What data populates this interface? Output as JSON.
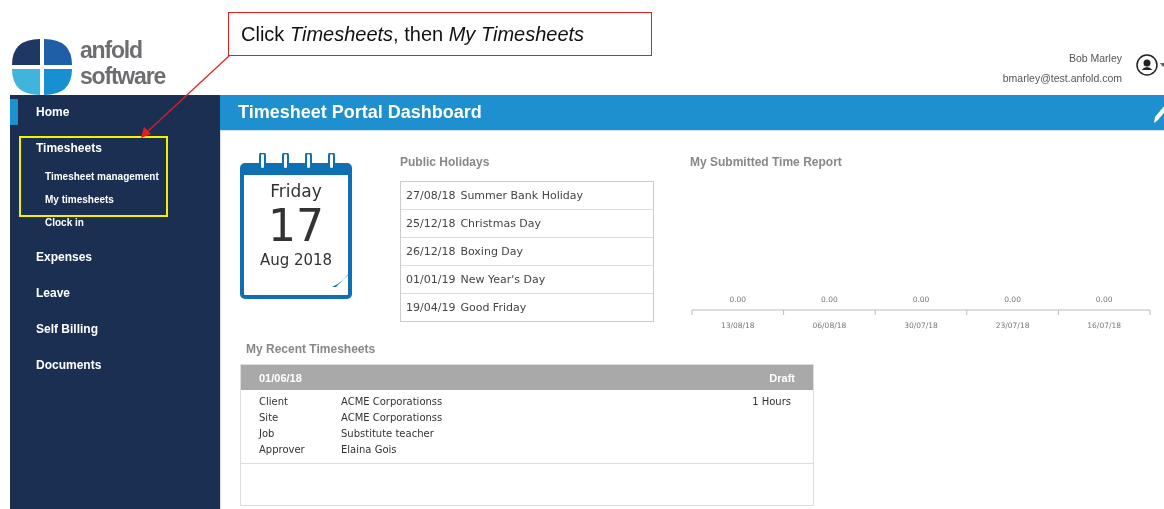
{
  "logo": {
    "lines": [
      "anfold",
      "software"
    ]
  },
  "user": {
    "name": "Bob Marley",
    "email": "bmarley@test.anfold.com"
  },
  "sidebar": {
    "items": [
      {
        "label": "Home",
        "selected": true
      },
      {
        "label": "Timesheets",
        "selected": false,
        "expanded": true,
        "children": [
          {
            "label": "Timesheet management"
          },
          {
            "label": "My timesheets"
          },
          {
            "label": "Clock in"
          }
        ]
      },
      {
        "label": "Expenses",
        "selected": false
      },
      {
        "label": "Leave",
        "selected": false
      },
      {
        "label": "Self Billing",
        "selected": false
      },
      {
        "label": "Documents",
        "selected": false
      }
    ]
  },
  "page_title": "Timesheet Portal Dashboard",
  "date_card": {
    "weekday": "Friday",
    "day": "17",
    "month_year": "Aug 2018"
  },
  "public_holidays": {
    "title": "Public Holidays",
    "rows": [
      {
        "date": "27/08/18",
        "name": "Summer Bank Holiday"
      },
      {
        "date": "25/12/18",
        "name": "Christmas Day"
      },
      {
        "date": "26/12/18",
        "name": "Boxing Day"
      },
      {
        "date": "01/01/19",
        "name": "New Year's Day"
      },
      {
        "date": "19/04/19",
        "name": "Good Friday"
      }
    ]
  },
  "time_report": {
    "title": "My Submitted Time Report",
    "columns": [
      {
        "value": "0.00",
        "label": "13/08/18"
      },
      {
        "value": "0.00",
        "label": "06/08/18"
      },
      {
        "value": "0.00",
        "label": "30/07/18"
      },
      {
        "value": "0.00",
        "label": "23/07/18"
      },
      {
        "value": "0.00",
        "label": "16/07/18"
      }
    ]
  },
  "recent_timesheets": {
    "title": "My Recent Timesheets",
    "items": [
      {
        "date": "01/06/18",
        "status": "Draft",
        "hours": "1 Hours",
        "fields": [
          {
            "label": "Client",
            "value": "ACME Corporationss"
          },
          {
            "label": "Site",
            "value": "ACME Corporationss"
          },
          {
            "label": "Job",
            "value": "Substitute teacher"
          },
          {
            "label": "Approver",
            "value": "Elaina Gois"
          }
        ]
      }
    ]
  },
  "annotation": {
    "text": "Click *Timesheets*, then *My Timesheets*"
  }
}
